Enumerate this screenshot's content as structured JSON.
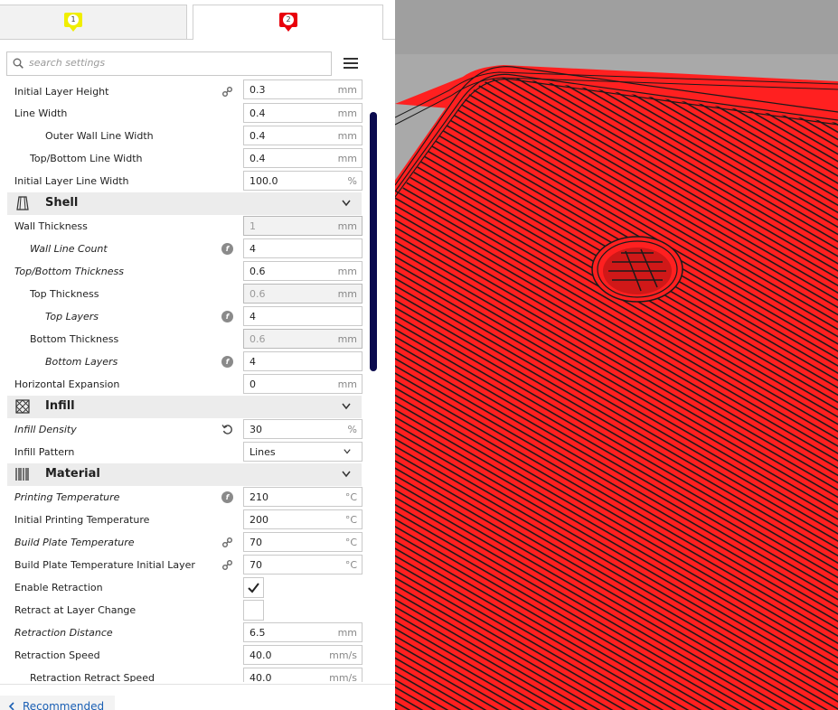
{
  "tabs": [
    {
      "badge": "1",
      "color": "#f0ee00"
    },
    {
      "badge": "2",
      "color": "#e8000b"
    }
  ],
  "search": {
    "placeholder": "search settings"
  },
  "rows": {
    "initial_layer_height": {
      "label": "Initial Layer Height",
      "value": "0.3",
      "unit": "mm"
    },
    "line_width": {
      "label": "Line Width",
      "value": "0.4",
      "unit": "mm"
    },
    "outer_wall_line_width": {
      "label": "Outer Wall Line Width",
      "value": "0.4",
      "unit": "mm"
    },
    "top_bottom_line_width": {
      "label": "Top/Bottom Line Width",
      "value": "0.4",
      "unit": "mm"
    },
    "initial_layer_line_width": {
      "label": "Initial Layer Line Width",
      "value": "100.0",
      "unit": "%"
    },
    "shell": {
      "title": "Shell"
    },
    "wall_thickness": {
      "label": "Wall Thickness",
      "value": "1",
      "unit": "mm"
    },
    "wall_line_count": {
      "label": "Wall Line Count",
      "value": "4"
    },
    "top_bottom_thickness": {
      "label": "Top/Bottom Thickness",
      "value": "0.6",
      "unit": "mm"
    },
    "top_thickness": {
      "label": "Top Thickness",
      "value": "0.6",
      "unit": "mm"
    },
    "top_layers": {
      "label": "Top Layers",
      "value": "4"
    },
    "bottom_thickness": {
      "label": "Bottom Thickness",
      "value": "0.6",
      "unit": "mm"
    },
    "bottom_layers": {
      "label": "Bottom Layers",
      "value": "4"
    },
    "horizontal_expansion": {
      "label": "Horizontal Expansion",
      "value": "0",
      "unit": "mm"
    },
    "infill": {
      "title": "Infill"
    },
    "infill_density": {
      "label": "Infill Density",
      "value": "30",
      "unit": "%"
    },
    "infill_pattern": {
      "label": "Infill Pattern",
      "value": "Lines"
    },
    "material": {
      "title": "Material"
    },
    "printing_temperature": {
      "label": "Printing Temperature",
      "value": "210",
      "unit": "°C"
    },
    "initial_printing_temperature": {
      "label": "Initial Printing Temperature",
      "value": "200",
      "unit": "°C"
    },
    "build_plate_temperature": {
      "label": "Build Plate Temperature",
      "value": "70",
      "unit": "°C"
    },
    "build_plate_temperature_initial": {
      "label": "Build Plate Temperature Initial Layer",
      "value": "70",
      "unit": "°C"
    },
    "enable_retraction": {
      "label": "Enable Retraction",
      "checked": true
    },
    "retract_at_layer_change": {
      "label": "Retract at Layer Change",
      "checked": false
    },
    "retraction_distance": {
      "label": "Retraction Distance",
      "value": "6.5",
      "unit": "mm"
    },
    "retraction_speed": {
      "label": "Retraction Speed",
      "value": "40.0",
      "unit": "mm/s"
    },
    "retraction_retract_speed": {
      "label": "Retraction Retract Speed",
      "value": "40.0",
      "unit": "mm/s"
    }
  },
  "footer": {
    "recommended_label": "Recommended"
  },
  "colors": {
    "accent": "#0b0b4e",
    "print": "#ff2020",
    "link": "#1a5fb4"
  }
}
